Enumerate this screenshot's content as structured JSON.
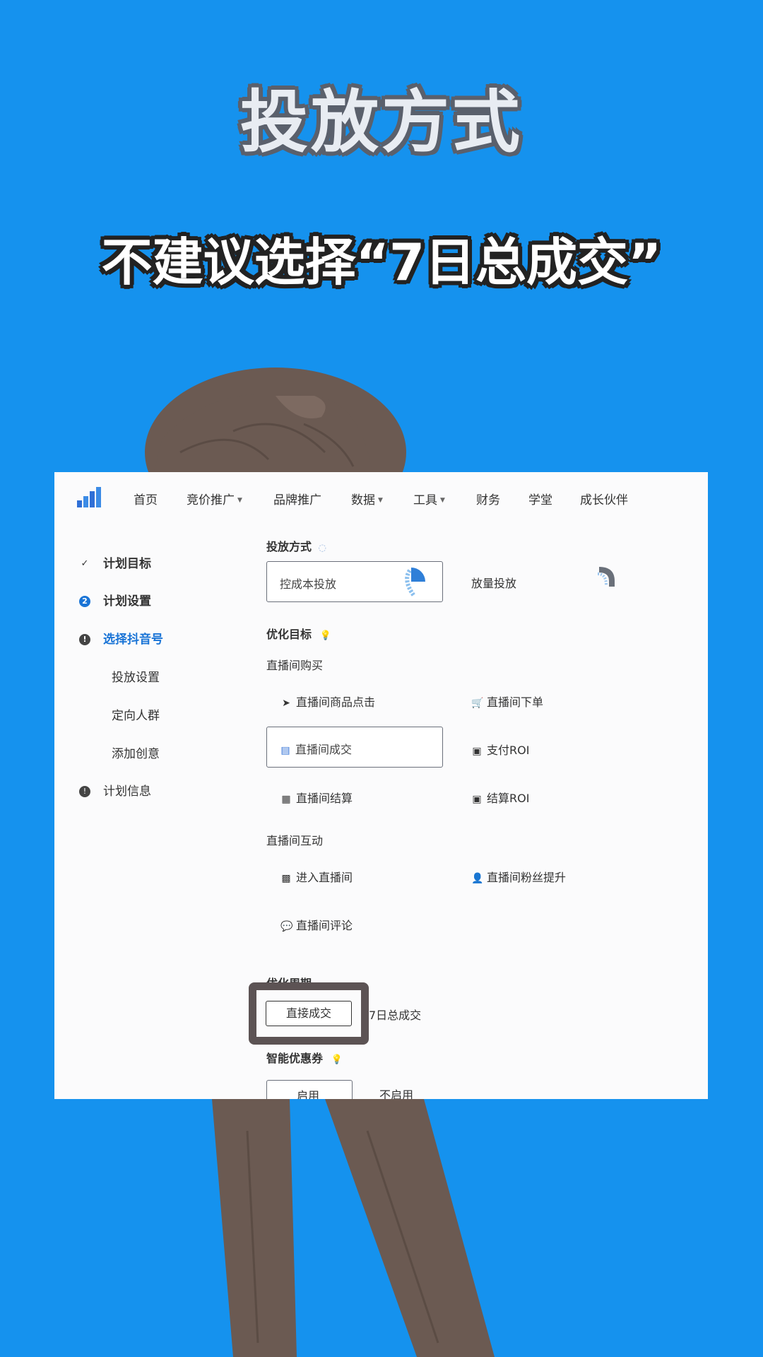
{
  "overlay": {
    "title": "投放方式",
    "subtitle": "不建议选择“7日总成交”"
  },
  "nav": {
    "items": [
      {
        "label": "首页"
      },
      {
        "label": "竞价推广"
      },
      {
        "label": "品牌推广"
      },
      {
        "label": "数据"
      },
      {
        "label": "工具"
      },
      {
        "label": "财务"
      },
      {
        "label": "学堂"
      },
      {
        "label": "成长伙伴"
      }
    ]
  },
  "steps": [
    {
      "label": "计划目标"
    },
    {
      "label": "计划设置",
      "marker": "2"
    },
    {
      "label": "选择抖音号"
    },
    {
      "label": "投放设置"
    },
    {
      "label": "定向人群"
    },
    {
      "label": "添加创意"
    },
    {
      "label": "计划信息"
    }
  ],
  "bid": {
    "section_label": "投放方式",
    "options": [
      "控成本投放",
      "放量投放"
    ]
  },
  "goal": {
    "section_label": "优化目标",
    "group1_label": "直播间购买",
    "group1": [
      "直播间商品点击",
      "直播间下单",
      "直播间成交",
      "支付ROI",
      "直播间结算",
      "结算ROI"
    ],
    "group2_label": "直播间互动",
    "group2": [
      "进入直播间",
      "直播间粉丝提升",
      "直播间评论"
    ]
  },
  "period": {
    "section_label": "优化周期",
    "options": [
      "直接成交",
      "7日总成交"
    ]
  },
  "coupon": {
    "section_label": "智能优惠券",
    "options": [
      "启用",
      "不启用"
    ]
  },
  "colors": {
    "background": "#1592ee",
    "active_step": "#1a74d6",
    "highlight_frame": "#5c5354"
  }
}
